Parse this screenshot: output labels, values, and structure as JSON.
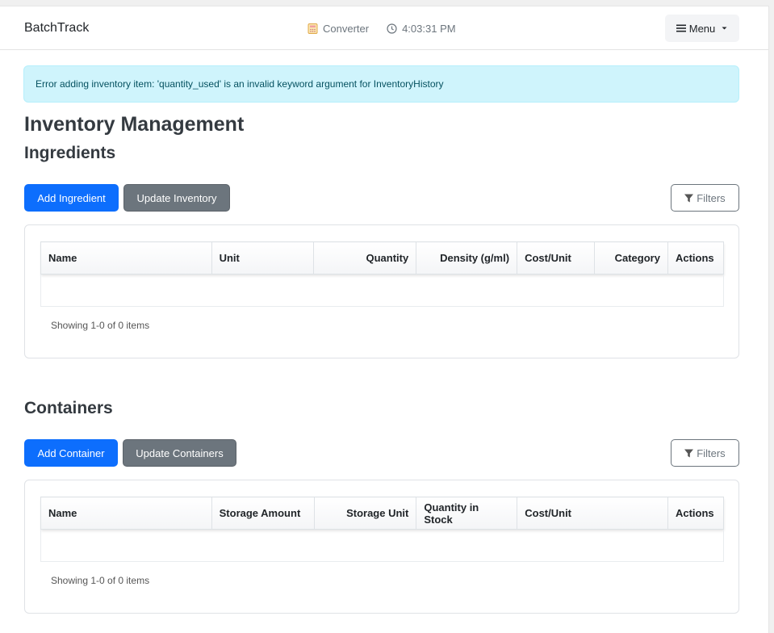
{
  "navbar": {
    "brand": "BatchTrack",
    "converter_label": "Converter",
    "clock_label": "4:03:31 PM",
    "menu_label": "Menu"
  },
  "alert": {
    "message": "Error adding inventory item: 'quantity_used' is an invalid keyword argument for InventoryHistory"
  },
  "page": {
    "title": "Inventory Management"
  },
  "ingredients": {
    "heading": "Ingredients",
    "add_label": "Add Ingredient",
    "update_label": "Update Inventory",
    "filters_label": "Filters",
    "columns": [
      "Name",
      "Unit",
      "Quantity",
      "Density (g/ml)",
      "Cost/Unit",
      "Category",
      "Actions"
    ],
    "rows": [],
    "showing": "Showing 1-0 of 0 items"
  },
  "containers": {
    "heading": "Containers",
    "add_label": "Add Container",
    "update_label": "Update Containers",
    "filters_label": "Filters",
    "columns": [
      "Name",
      "Storage Amount",
      "Storage Unit",
      "Quantity in Stock",
      "Cost/Unit",
      "Actions"
    ],
    "rows": [],
    "showing": "Showing 1-0 of 0 items"
  },
  "colors": {
    "primary": "#0d6efd",
    "secondary": "#6c757d",
    "alert_bg": "#cff4fc",
    "alert_text": "#055160"
  },
  "icons": {
    "converter": "calculator-icon",
    "clock": "clock-icon",
    "menu": "hamburger-icon",
    "caret": "caret-down-icon",
    "filter": "filter-funnel-icon"
  }
}
